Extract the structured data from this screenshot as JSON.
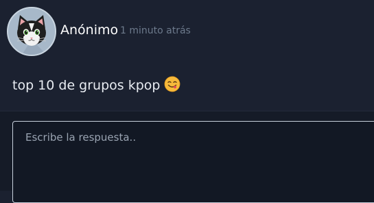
{
  "post": {
    "author": "Anónimo",
    "time": "1 minuto atrás",
    "text": "top 10 de grupos kpop",
    "avatar_icon": "cat-avatar-icon",
    "emoji_icon": "face-savoring-food-emoji-icon"
  },
  "reply": {
    "placeholder": "Escribe la respuesta.."
  },
  "colors": {
    "background": "#1b2130",
    "reply_background": "#151b27",
    "author": "#ffffff",
    "time": "#6d7a8c",
    "input_border": "#c9d2de"
  }
}
